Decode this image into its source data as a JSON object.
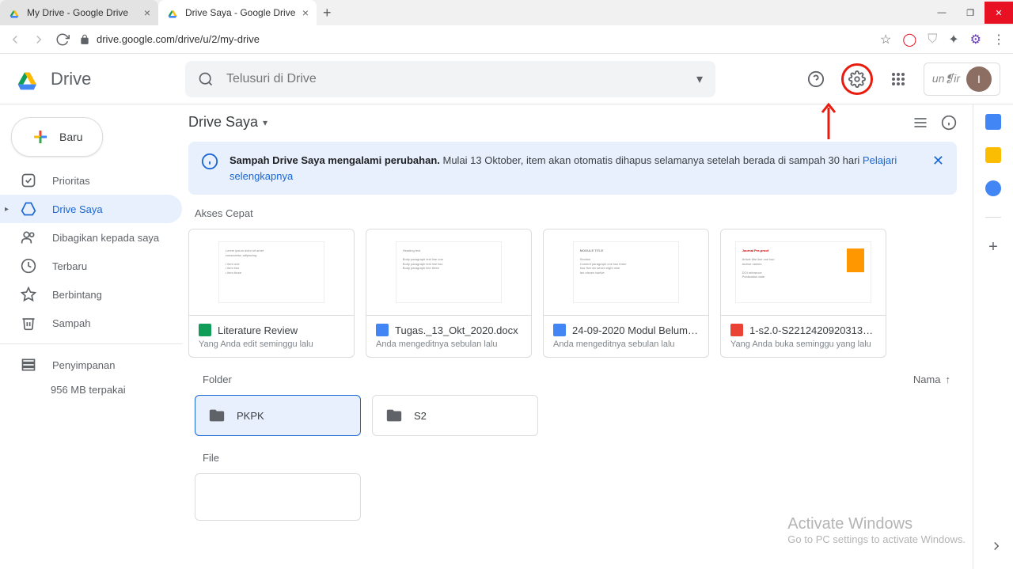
{
  "browser": {
    "tabs": [
      {
        "title": "My Drive - Google Drive",
        "active": false
      },
      {
        "title": "Drive Saya - Google Drive",
        "active": true
      }
    ],
    "url": "drive.google.com/drive/u/2/my-drive"
  },
  "header": {
    "app_name": "Drive",
    "search_placeholder": "Telusuri di Drive",
    "org_name": "un❡ir",
    "avatar_initial": "I"
  },
  "sidebar": {
    "new_label": "Baru",
    "items": [
      {
        "label": "Prioritas"
      },
      {
        "label": "Drive Saya"
      },
      {
        "label": "Dibagikan kepada saya"
      },
      {
        "label": "Terbaru"
      },
      {
        "label": "Berbintang"
      },
      {
        "label": "Sampah"
      }
    ],
    "storage_label": "Penyimpanan",
    "storage_used": "956 MB terpakai"
  },
  "content": {
    "breadcrumb": "Drive Saya",
    "banner": {
      "bold": "Sampah Drive Saya mengalami perubahan.",
      "text": " Mulai 13 Oktober, item akan otomatis dihapus selamanya setelah berada di sampah 30 hari ",
      "link": "Pelajari selengkapnya"
    },
    "quick_access_title": "Akses Cepat",
    "quick_access": [
      {
        "title": "Literature Review",
        "subtitle": "Yang Anda edit seminggu lalu",
        "type": "sheets"
      },
      {
        "title": "Tugas._13_Okt_2020.docx",
        "subtitle": "Anda mengeditnya sebulan lalu",
        "type": "docs"
      },
      {
        "title": "24-09-2020 Modul Belum F...",
        "subtitle": "Anda mengeditnya sebulan lalu",
        "type": "docs"
      },
      {
        "title": "1-s2.0-S221242092031397...",
        "subtitle": "Yang Anda buka seminggu yang lalu",
        "type": "pdf"
      }
    ],
    "folder_label": "Folder",
    "sort_label": "Nama",
    "folders": [
      {
        "name": "PKPK",
        "selected": true
      },
      {
        "name": "S2",
        "selected": false
      }
    ],
    "file_label": "File"
  },
  "watermark": {
    "title": "Activate Windows",
    "sub": "Go to PC settings to activate Windows."
  }
}
